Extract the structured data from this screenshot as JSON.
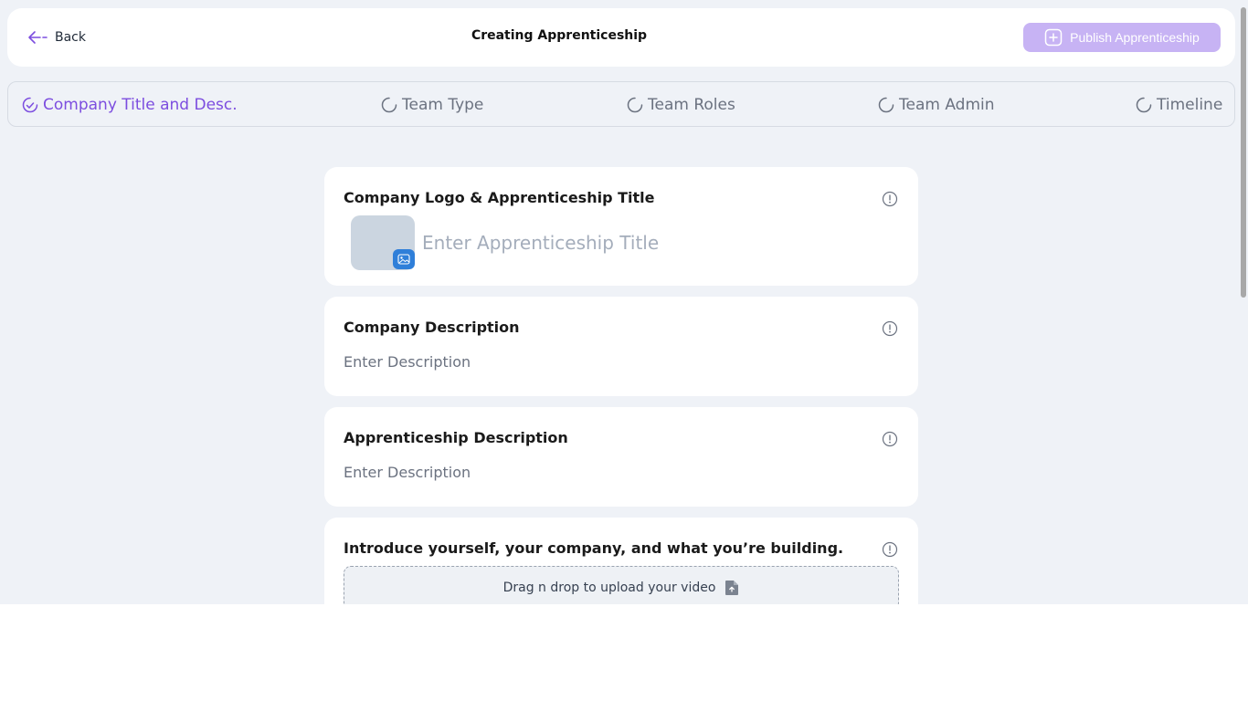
{
  "header": {
    "back_label": "Back",
    "title": "Creating Apprenticeship",
    "publish_label": "Publish Apprenticeship"
  },
  "steps": [
    {
      "label": "Company Title and Desc.",
      "active": true
    },
    {
      "label": "Team Type",
      "active": false
    },
    {
      "label": "Team Roles",
      "active": false
    },
    {
      "label": "Team Admin",
      "active": false
    },
    {
      "label": "Timeline",
      "active": false
    }
  ],
  "sections": {
    "logo_title": {
      "heading": "Company Logo & Apprenticeship Title",
      "title_placeholder": "Enter Apprenticeship Title"
    },
    "company_description": {
      "heading": "Company Description",
      "placeholder": "Enter Description"
    },
    "apprenticeship_description": {
      "heading": "Apprenticeship Description",
      "placeholder": "Enter Description"
    },
    "intro_video": {
      "heading": "Introduce yourself, your company, and what you’re building.",
      "upload_label": "Drag n drop to upload your video"
    }
  },
  "colors": {
    "accent": "#7c4ddf",
    "publish_bg": "#c7b3f4",
    "page_bg": "#eff2f7",
    "logo_button": "#2f7fd9"
  },
  "icons": [
    "arrow-left-icon",
    "plus-square-icon",
    "check-circle-icon",
    "loading-circle-icon",
    "info-icon",
    "image-icon",
    "file-upload-icon"
  ]
}
